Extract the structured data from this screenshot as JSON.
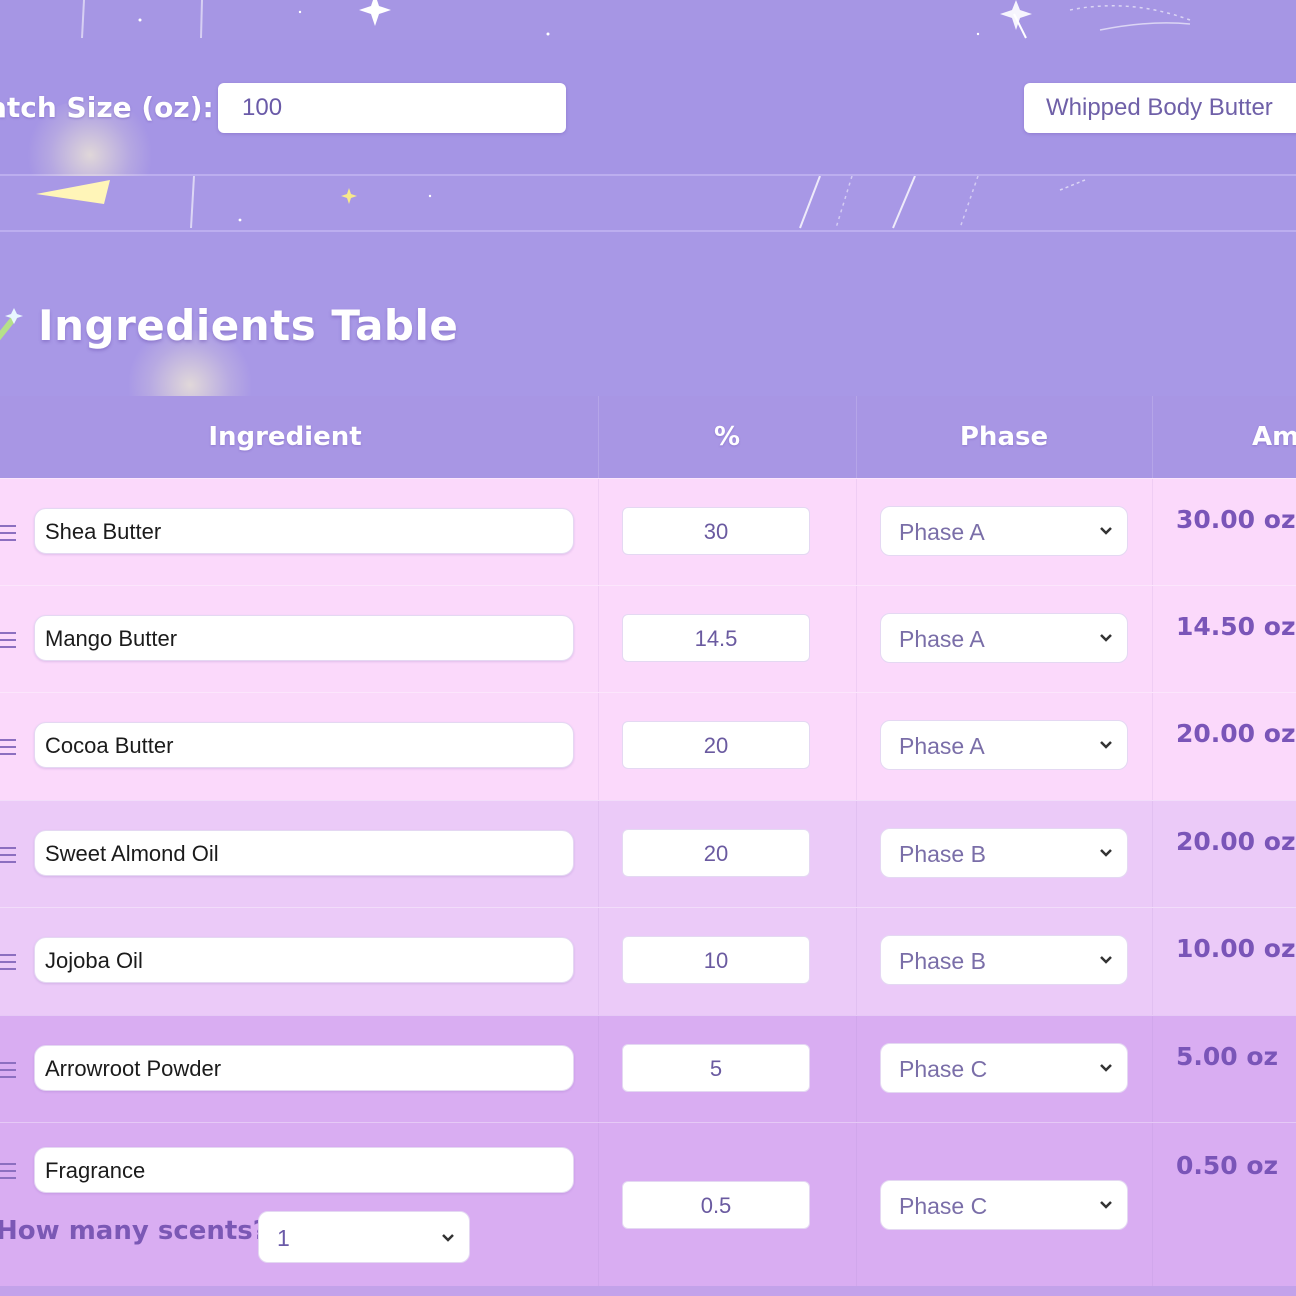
{
  "batch": {
    "size_label": "atch Size (oz):",
    "size_value": "100",
    "product_type": "Whipped Body Butter"
  },
  "section": {
    "title": "Ingredients Table",
    "icon": "magic-wand-icon"
  },
  "table": {
    "headers": [
      "Ingredient",
      "%",
      "Phase",
      "Am"
    ],
    "rows": [
      {
        "ingredient": "Shea Butter",
        "percent": "30",
        "phase": "Phase A",
        "amount": "30.00 oz"
      },
      {
        "ingredient": "Mango Butter",
        "percent": "14.5",
        "phase": "Phase A",
        "amount": "14.50 oz"
      },
      {
        "ingredient": "Cocoa Butter",
        "percent": "20",
        "phase": "Phase A",
        "amount": "20.00 oz"
      },
      {
        "ingredient": "Sweet Almond Oil",
        "percent": "20",
        "phase": "Phase B",
        "amount": "20.00 oz"
      },
      {
        "ingredient": "Jojoba Oil",
        "percent": "10",
        "phase": "Phase B",
        "amount": "10.00 oz"
      },
      {
        "ingredient": "Arrowroot Powder",
        "percent": "5",
        "phase": "Phase C",
        "amount": "5.00 oz"
      },
      {
        "ingredient": "Fragrance",
        "percent": "0.5",
        "phase": "Phase C",
        "amount": "0.50 oz"
      }
    ]
  },
  "scents": {
    "label": "How many scents?",
    "value": "1"
  },
  "colors": {
    "background": "#a898e6",
    "phase_a_row": "#fbd9fb",
    "phase_b_row": "#ebcaf8",
    "phase_c_row": "#d9adf2",
    "amount_text": "#7a55b8"
  }
}
